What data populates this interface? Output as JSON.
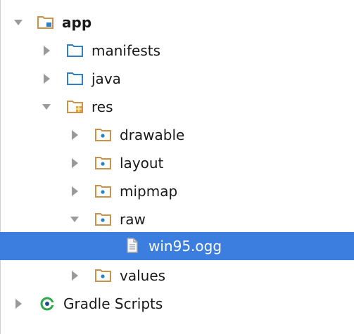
{
  "colors": {
    "selection": "#3b7ee0",
    "folder_blue": "#2f7fc5",
    "folder_tan": "#c9944a",
    "arrow": "#9a9a9a"
  },
  "tree": {
    "app": {
      "label": "app",
      "state": "expanded",
      "icon": "module-folder-icon"
    },
    "manifests": {
      "label": "manifests",
      "state": "collapsed",
      "icon": "folder-icon"
    },
    "java": {
      "label": "java",
      "state": "collapsed",
      "icon": "folder-icon"
    },
    "res": {
      "label": "res",
      "state": "expanded",
      "icon": "resource-folder-icon"
    },
    "drawable": {
      "label": "drawable",
      "state": "collapsed",
      "icon": "package-folder-icon"
    },
    "layout": {
      "label": "layout",
      "state": "collapsed",
      "icon": "package-folder-icon"
    },
    "mipmap": {
      "label": "mipmap",
      "state": "collapsed",
      "icon": "package-folder-icon"
    },
    "raw": {
      "label": "raw",
      "state": "expanded",
      "icon": "package-folder-icon"
    },
    "win95": {
      "label": "win95.ogg",
      "state": "selected",
      "icon": "file-icon"
    },
    "values": {
      "label": "values",
      "state": "collapsed",
      "icon": "package-folder-icon"
    },
    "gradle": {
      "label": "Gradle Scripts",
      "state": "collapsed",
      "icon": "gradle-icon"
    }
  }
}
